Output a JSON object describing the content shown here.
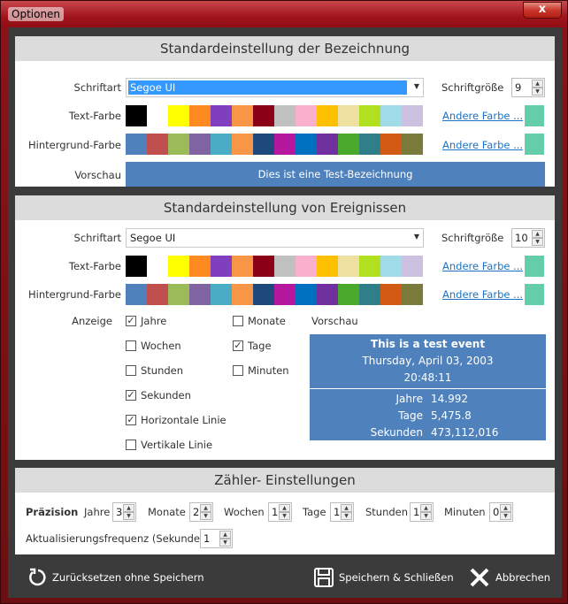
{
  "window": {
    "title": "Optionen",
    "close_label": "x"
  },
  "section1": {
    "header": "Standardeinstellung der Bezeichnung",
    "font_label": "Schriftart",
    "font_value": "Segoe UI",
    "size_label": "Schriftgröße",
    "size_value": "9",
    "text_color_label": "Text-Farbe",
    "bg_color_label": "Hintergrund-Farbe",
    "other_color_link": "Andere Farbe ...",
    "preview_label": "Vorschau",
    "preview_text": "Dies ist eine Test-Bezeichnung"
  },
  "section2": {
    "header": "Standardeinstellung von Ereignissen",
    "font_label": "Schriftart",
    "font_value": "Segoe UI",
    "size_label": "Schriftgröße",
    "size_value": "10",
    "text_color_label": "Text-Farbe",
    "bg_color_label": "Hintergrund-Farbe",
    "other_color_link": "Andere Farbe ...",
    "display_label": "Anzeige",
    "preview_label": "Vorschau",
    "options": {
      "years": {
        "label": "Jahre",
        "checked": true
      },
      "weeks": {
        "label": "Wochen",
        "checked": false
      },
      "hours": {
        "label": "Stunden",
        "checked": false
      },
      "seconds": {
        "label": "Sekunden",
        "checked": true
      },
      "hline": {
        "label": "Horizontale Linie",
        "checked": true
      },
      "vline": {
        "label": "Vertikale Linie",
        "checked": false
      },
      "months": {
        "label": "Monate",
        "checked": false
      },
      "days": {
        "label": "Tage",
        "checked": true
      },
      "minutes": {
        "label": "Minuten",
        "checked": false
      }
    },
    "event": {
      "title": "This is a test event",
      "date": "Thursday, April 03, 2003",
      "time": "20:48:11",
      "rows": [
        {
          "label": "Jahre",
          "value": "14.992"
        },
        {
          "label": "Tage",
          "value": "5,475.8"
        },
        {
          "label": "Sekunden",
          "value": "473,112,016"
        }
      ]
    }
  },
  "section3": {
    "header": "Zähler- Einstellungen",
    "precision_label": "Präzision",
    "years_label": "Jahre",
    "years_value": "3",
    "months_label": "Monate",
    "months_value": "2",
    "weeks_label": "Wochen",
    "weeks_value": "1",
    "days_label": "Tage",
    "days_value": "1",
    "hours_label": "Stunden",
    "hours_value": "1",
    "minutes_label": "Minuten",
    "minutes_value": "0",
    "update_label": "Aktualisierungsfrequenz (Sekunden)",
    "update_value": "1"
  },
  "footer": {
    "reset_label": "Zurücksetzen ohne Speichern",
    "save_label": "Speichern & Schließen",
    "cancel_label": "Abbrechen"
  },
  "colors": {
    "text_palette": [
      "#000000",
      "#ffffff",
      "#ffff00",
      "#ff8a1f",
      "#7f3fbf",
      "#f79646",
      "#8b0016",
      "#c0c0c0",
      "#f9b0cc",
      "#ffc000",
      "#eee0a0",
      "#b0e020",
      "#a0dbe8",
      "#ccc0e0"
    ],
    "bg_palette": [
      "#4f81bd",
      "#c0504d",
      "#9bbb59",
      "#8064a2",
      "#4bacc6",
      "#f79646",
      "#1f497d",
      "#b5179e",
      "#0070c0",
      "#7030a0",
      "#4aa82a",
      "#2e7f87",
      "#d35a14",
      "#7a7a3a"
    ],
    "custom_swatch": "#66cdaa",
    "preview_bg": "#4f81bd"
  }
}
